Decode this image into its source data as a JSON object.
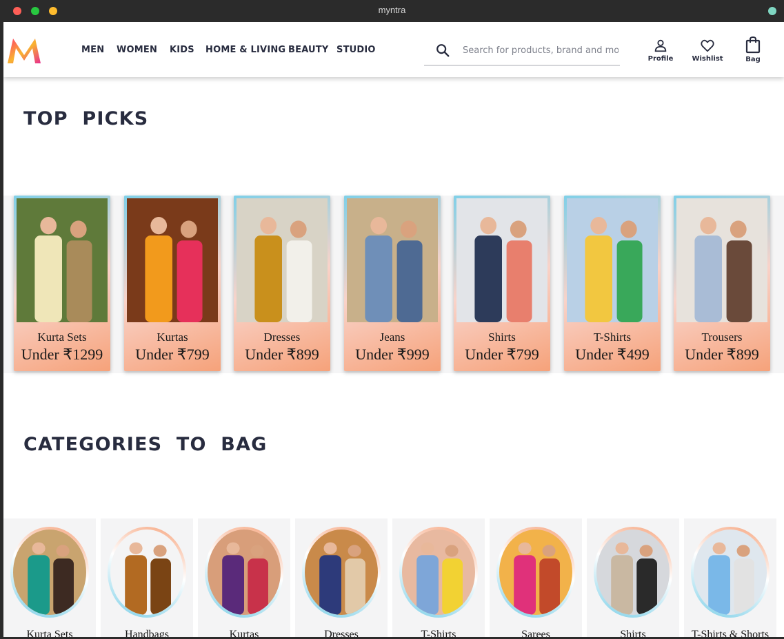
{
  "window": {
    "title": "myntra"
  },
  "brand": {
    "accent": "#ff3f6c",
    "gradient": [
      "#ff3f6c",
      "#f9b42f",
      "#e82e8d"
    ]
  },
  "nav": [
    "MEN",
    "WOMEN",
    "KIDS",
    "HOME & LIVING",
    "BEAUTY",
    "STUDIO"
  ],
  "search": {
    "placeholder": "Search for products, brand and more",
    "icon": "search-icon"
  },
  "actions": [
    {
      "label": "Profile",
      "icon": "person-icon"
    },
    {
      "label": "Wishlist",
      "icon": "heart-icon"
    },
    {
      "label": "Bag",
      "icon": "bag-icon"
    }
  ],
  "top_picks": {
    "title": "TOP  PICKS",
    "items": [
      {
        "name": "Kurta Sets",
        "price": "Under ₹1299"
      },
      {
        "name": "Kurtas",
        "price": "Under ₹799"
      },
      {
        "name": "Dresses",
        "price": "Under ₹899"
      },
      {
        "name": "Jeans",
        "price": "Under ₹999"
      },
      {
        "name": "Shirts",
        "price": "Under ₹799"
      },
      {
        "name": "T-Shirts",
        "price": "Under ₹499"
      },
      {
        "name": "Trousers",
        "price": "Under ₹899"
      }
    ]
  },
  "categories": {
    "title": "CATEGORIES  TO  BAG",
    "items": [
      {
        "name": "Kurta Sets"
      },
      {
        "name": "Handbags"
      },
      {
        "name": "Kurtas"
      },
      {
        "name": "Dresses"
      },
      {
        "name": "T-Shirts"
      },
      {
        "name": "Sarees"
      },
      {
        "name": "Shirts"
      },
      {
        "name": "T-Shirts & Shorts"
      }
    ]
  }
}
